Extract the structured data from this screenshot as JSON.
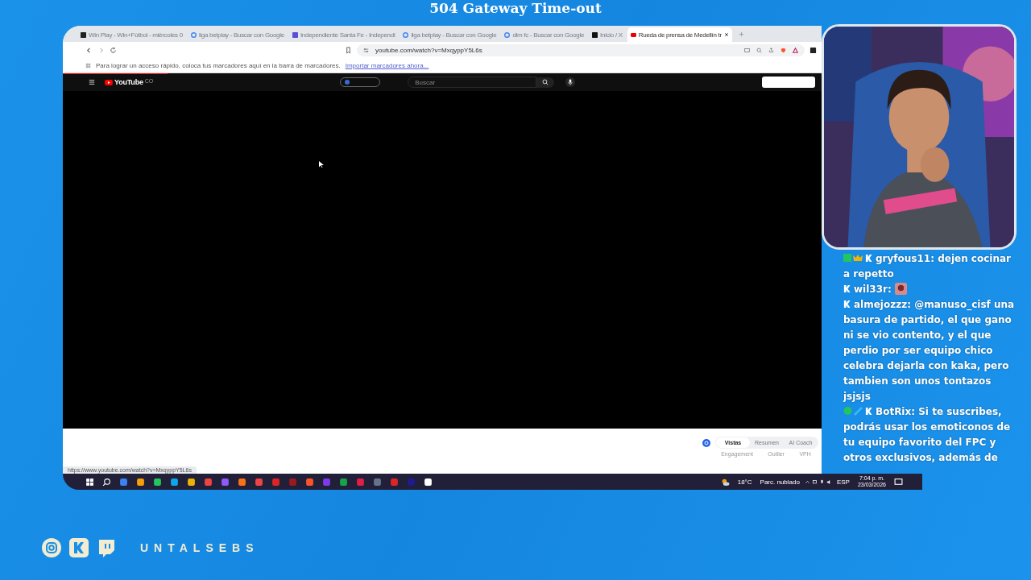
{
  "page_title": "504 Gateway Time-out",
  "browser": {
    "tabs": [
      {
        "title": "Win Play - Win+Fútbol - miércoles 0",
        "kind": "dark",
        "selected": false
      },
      {
        "title": "liga betplay - Buscar con Google",
        "kind": "google",
        "selected": false
      },
      {
        "title": "Independiente Santa Fe - Independi",
        "kind": "purple",
        "selected": false
      },
      {
        "title": "liga betplay - Buscar con Google",
        "kind": "google",
        "selected": false
      },
      {
        "title": "dim fc - Buscar con Google",
        "kind": "google",
        "selected": false
      },
      {
        "title": "Inicio / X",
        "kind": "x",
        "selected": false
      },
      {
        "title": "Rueda de prensa de Medellín tr",
        "kind": "youtube",
        "selected": true
      }
    ],
    "address": "youtube.com/watch?v=MxqyppY5L6s",
    "bookmarks_hint": "Para lograr un acceso rápido, coloca tus marcadores aquí en la barra de marcadores.",
    "bookmarks_link": "Importar marcadores ahora...",
    "status_url": "https://www.youtube.com/watch?v=MxqyppY5L6s"
  },
  "youtube": {
    "logo": "YouTube",
    "country": "CO",
    "search": {
      "placeholder": "Buscar"
    },
    "panel_tabs": [
      {
        "label": "Vistas",
        "selected": true
      },
      {
        "label": "Resumen",
        "selected": false
      },
      {
        "label": "AI Coach",
        "selected": false
      }
    ],
    "metrics": [
      "Engagement",
      "Outlier",
      "VPH"
    ]
  },
  "taskbar": {
    "weather": "18°C",
    "forecast": "Parc. nublado",
    "language": "ESP",
    "time": "7:04 p. m.",
    "date": "23/03/2026"
  },
  "chat": [
    {
      "kind": "subscriber",
      "user": "gryfous11:",
      "text": "dejen cocinar a repetto"
    },
    {
      "kind": "viewer",
      "user": "wil33r:",
      "emote": true
    },
    {
      "kind": "viewer",
      "user": "almejozzz:",
      "text": "@manuso_cisf una basura de partido, el que gano ni se vio contento, y el que perdio por ser equipo chico celebra dejarla con kaka, pero tambien son unos tontazos jsjsjs"
    },
    {
      "kind": "bot",
      "user": "BotRix:",
      "text": "Si te suscribes, podrás usar los emoticonos de tu equipo favorito del FPC y otros exclusivos, además de"
    }
  ],
  "channel": "UNTALSEBS"
}
